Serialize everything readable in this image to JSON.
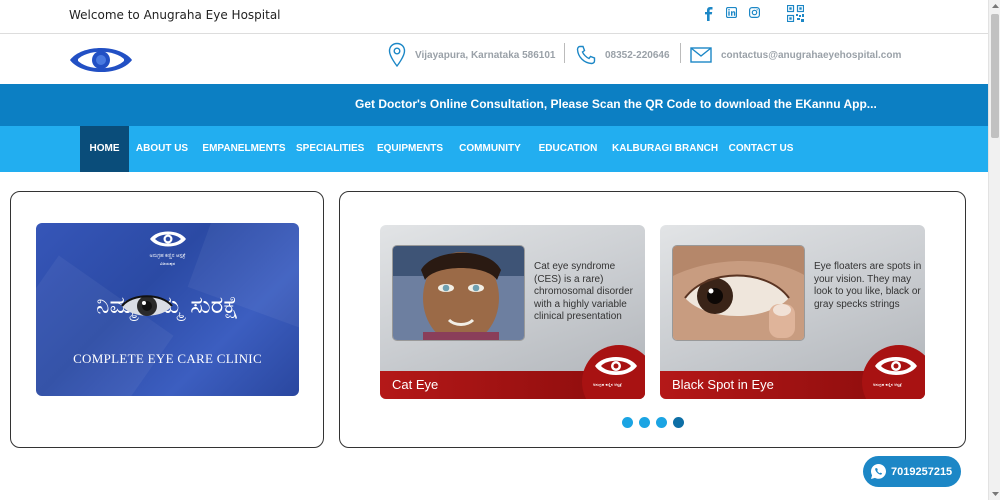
{
  "header": {
    "welcome": "Welcome to Anugraha Eye Hospital",
    "social_icons": [
      "facebook-icon",
      "linkedin-icon",
      "instagram-icon",
      "qr-code-icon"
    ]
  },
  "contact": {
    "address": "Vijayapura, Karnataka 586101",
    "phone": "08352-220646",
    "email": "contactus@anugrahaeyehospital.com"
  },
  "banner": {
    "text": "Get Doctor's Online Consultation, Please Scan the QR Code to download the EKannu App..."
  },
  "nav": {
    "items": [
      "HOME",
      "ABOUT US",
      "EMPANELMENTS",
      "SPECIALITIES",
      "EQUIPMENTS",
      "COMMUNITY",
      "EDUCATION",
      "KALBURAGI BRANCH",
      "CONTACT US"
    ],
    "active": "HOME"
  },
  "clinic_card": {
    "kannada_title": "ನಿಮ್ಮ  ನಮ್ಮ ಸುರಕ್ಷೆ",
    "subtitle": "COMPLETE EYE CARE CLINIC"
  },
  "slides": [
    {
      "title": "Cat Eye",
      "description": "Cat eye syndrome (CES) is a rare) chromosomal disorder with a highly variable clinical presentation"
    },
    {
      "title": "Black Spot in Eye",
      "description": "Eye floaters are spots in your vision. They may look to you like, black or gray specks strings"
    }
  ],
  "carousel": {
    "count": 4,
    "active_index": 4
  },
  "whatsapp": {
    "number": "7019257215"
  },
  "colors": {
    "banner": "#0c7fc3",
    "nav": "#22aef0",
    "nav_active": "#0a4d7a",
    "slide_band": "#b41818",
    "clinic_card": "#3656b8"
  }
}
